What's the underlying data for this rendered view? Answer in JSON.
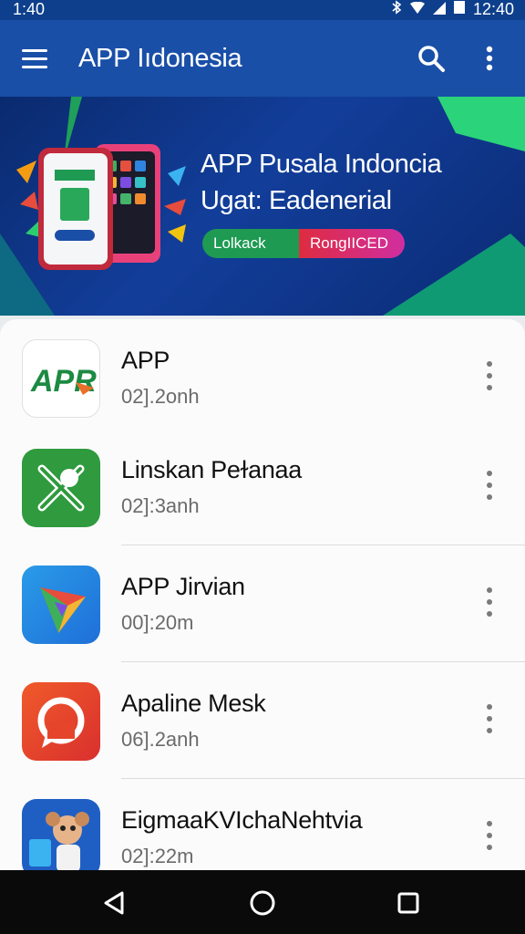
{
  "status_bar": {
    "time_left": "1:40",
    "time_right": "12:40",
    "icons": [
      "bluetooth-icon",
      "wifi-icon",
      "signal-icon",
      "battery-icon"
    ]
  },
  "app_bar": {
    "title": "APP Iıdonesia",
    "icons": [
      "menu-icon",
      "search-icon",
      "more-vert-icon"
    ]
  },
  "banner": {
    "title_line1": "APP Pusala Indoncia",
    "title_line2": "Ugat: Eadenerial",
    "button_green": "Lolkack",
    "button_red": "RongIICED"
  },
  "apps": [
    {
      "name": "APP",
      "meta": "02].2onh",
      "icon": "apr-logo-icon",
      "icon_text": "APR"
    },
    {
      "name": "Linskan Peɫanaa",
      "meta": "02]:3anh",
      "icon": "crossed-tools-icon"
    },
    {
      "name": "APP Jirvian",
      "meta": "00]:20m",
      "icon": "play-triangle-icon"
    },
    {
      "name": "Apaline Mesk",
      "meta": "06].2anh",
      "icon": "chat-bubble-icon"
    },
    {
      "name": "EigmaaKVIchaNehtvia",
      "meta": "02]:22m",
      "icon": "cartoon-character-icon"
    }
  ],
  "nav_bar": {
    "icons": [
      "back-icon",
      "home-icon",
      "recents-icon"
    ]
  },
  "colors": {
    "app_bar": "#1a4fa8",
    "status_bar": "#0d3f8c",
    "nav_bar": "#0a0a0a",
    "green_button": "#1e9a52",
    "red_button": "#e02b35"
  }
}
